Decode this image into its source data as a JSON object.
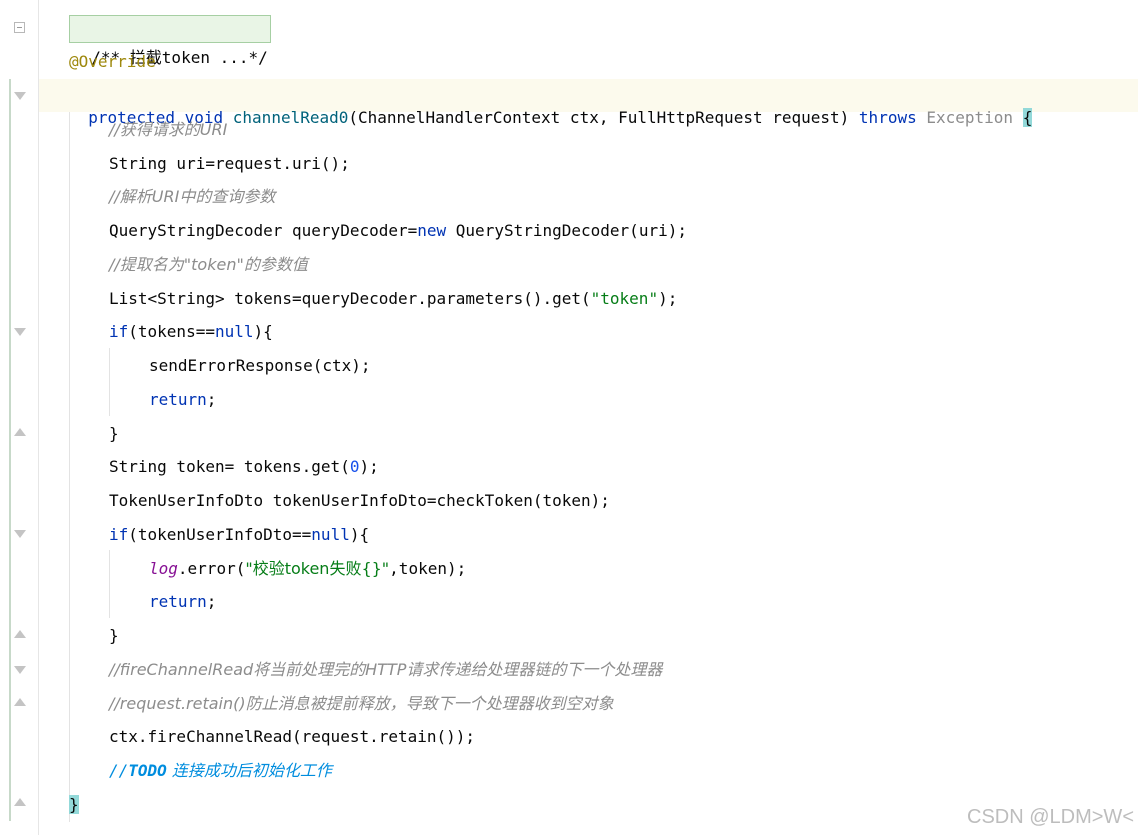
{
  "editor": {
    "folded_comment": "/** 拦截token ...*/",
    "annotation": "@Override",
    "signature": {
      "modifier": "protected",
      "return_type": "void",
      "method_name": "channelRead0",
      "params": "(ChannelHandlerContext ctx, FullHttpRequest request)",
      "throws_kw": "throws",
      "exception": "Exception",
      "open_brace": "{"
    },
    "lines": {
      "c1": "//获得请求的URI",
      "l1": "String uri=request.uri();",
      "c2": "//解析URI中的查询参数",
      "l2a": "QueryStringDecoder queryDecoder=",
      "l2_new": "new",
      "l2b": " QueryStringDecoder(uri);",
      "c3": "//提取名为\"token\"的参数值",
      "l3a": "List<String> tokens=queryDecoder.parameters().get(",
      "l3_str": "\"token\"",
      "l3b": ");",
      "if1_kw": "if",
      "if1_a": "(tokens==",
      "if1_null": "null",
      "if1_b": "){",
      "send_error": "sendErrorResponse(ctx);",
      "return1": "return",
      "semicolon": ";",
      "close1": "}",
      "l4a": "String token= tokens.get(",
      "l4_num": "0",
      "l4b": ");",
      "l5": "TokenUserInfoDto tokenUserInfoDto=checkToken(token);",
      "if2_kw": "if",
      "if2_a": "(tokenUserInfoDto==",
      "if2_null": "null",
      "if2_b": "){",
      "log_field": "log",
      "log_a": ".error(",
      "log_str": "\"校验token失败{}\"",
      "log_b": ",token);",
      "return2": "return",
      "close2": "}",
      "c4": "//fireChannelRead将当前处理完的HTTP请求传递给处理器链的下一个处理器",
      "c5": "//request.retain()防止消息被提前释放，导致下一个处理器收到空对象",
      "l6": "ctx.fireChannelRead(request.retain());",
      "todo_prefix": "//",
      "todo_kw": "TODO",
      "todo_text": " 连接成功后初始化工作",
      "close_method": "}"
    }
  },
  "watermark": "CSDN @LDM>W<",
  "colors": {
    "keyword": "#0033b3",
    "method": "#00627a",
    "annotation": "#9e880d",
    "comment": "#8c8c8c",
    "string": "#067d17",
    "number": "#1750eb",
    "todo": "#008dde",
    "field": "#871094",
    "brace_highlight": "#93d9d9",
    "current_line": "#fcfaed"
  }
}
